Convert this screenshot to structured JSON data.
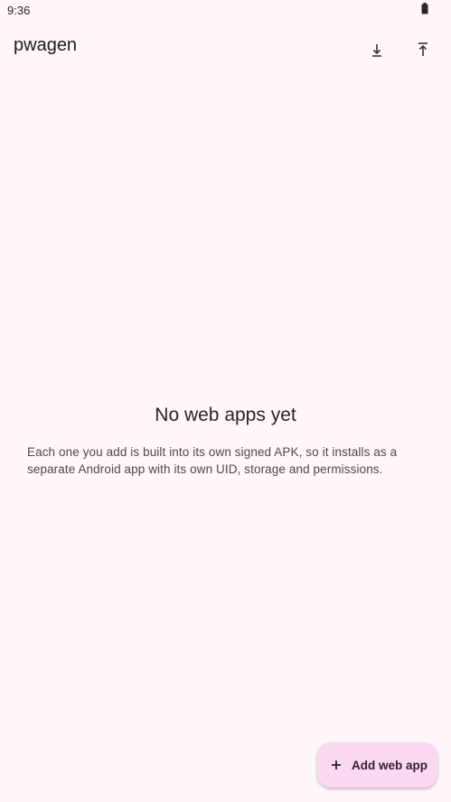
{
  "status_bar": {
    "time": "9:36"
  },
  "app_bar": {
    "title": "pwagen",
    "actions": [
      {
        "icon": "download-icon",
        "name": "import"
      },
      {
        "icon": "upload-icon",
        "name": "export"
      }
    ]
  },
  "empty_state": {
    "title": "No web apps yet",
    "description": "Each one you add is built into its own signed APK, so it installs as a separate Android app with its own UID, storage and permissions."
  },
  "fab": {
    "label": "Add web app",
    "icon": "plus-icon"
  },
  "colors": {
    "background": "#fff7fa",
    "fab_background": "#fbd9f1",
    "text_primary": "#1f1a1d",
    "text_secondary": "#4f474b"
  }
}
